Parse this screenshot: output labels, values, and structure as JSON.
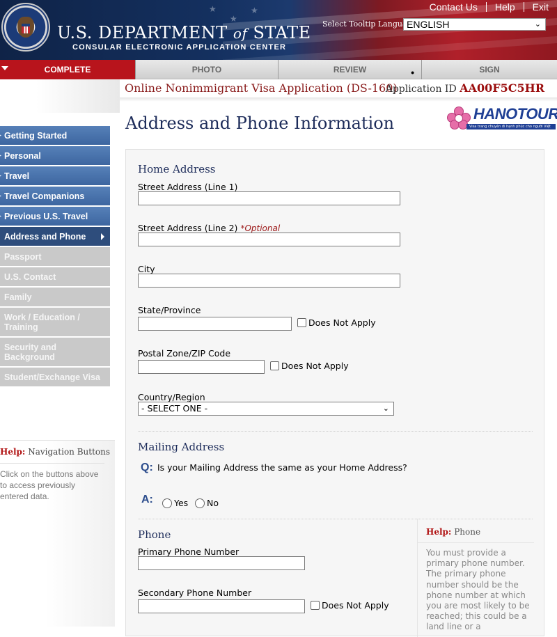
{
  "header": {
    "top_links": [
      "Contact Us",
      "Help",
      "Exit"
    ],
    "dept_title_pre": "U.S. Department ",
    "dept_title_of": "of",
    "dept_title_post": " State",
    "dept_subtitle": "CONSULAR ELECTRONIC APPLICATION CENTER",
    "tooltip_language_label": "Select Tooltip Language",
    "language_value": "ENGLISH"
  },
  "progress": {
    "steps": [
      "COMPLETE",
      "PHOTO",
      "REVIEW",
      "SIGN"
    ],
    "active": "COMPLETE"
  },
  "application": {
    "title": "Online Nonimmigrant Visa Application (DS-160)",
    "id_label": "Application ID",
    "id_value": "AA00F5C5HR"
  },
  "page": {
    "title": "Address and Phone Information"
  },
  "logo": {
    "text": "HANOTOURS",
    "tagline": "Visa trang chuyên đi hạnh phúc cho người Việt"
  },
  "nav": {
    "items": [
      {
        "label": "Getting Started",
        "state": "done"
      },
      {
        "label": "Personal",
        "state": "done"
      },
      {
        "label": "Travel",
        "state": "done"
      },
      {
        "label": "Travel Companions",
        "state": "done"
      },
      {
        "label": "Previous U.S. Travel",
        "state": "done"
      },
      {
        "label": "Address and Phone",
        "state": "current"
      },
      {
        "label": "Passport",
        "state": "todo"
      },
      {
        "label": "U.S. Contact",
        "state": "todo"
      },
      {
        "label": "Family",
        "state": "todo"
      },
      {
        "label": "Work / Education / Training",
        "state": "todo"
      },
      {
        "label": "Security and Background",
        "state": "todo"
      },
      {
        "label": "Student/Exchange Visa",
        "state": "todo"
      }
    ]
  },
  "side_help": {
    "prefix": "Help:",
    "title": "Navigation Buttons",
    "text": "Click on the buttons above to access previously entered data."
  },
  "home_address": {
    "section_title": "Home Address",
    "street1_label": "Street Address (Line 1)",
    "street1_value": "",
    "street2_label": "Street Address (Line 2)",
    "street2_optional": "*Optional",
    "street2_value": "",
    "city_label": "City",
    "city_value": "",
    "state_label": "State/Province",
    "state_value": "",
    "postal_label": "Postal Zone/ZIP Code",
    "postal_value": "",
    "does_not_apply": "Does Not Apply",
    "country_label": "Country/Region",
    "country_value": "- SELECT ONE -"
  },
  "mailing_address": {
    "section_title": "Mailing Address",
    "q_marker": "Q:",
    "question": "Is your Mailing Address the same as your Home Address?",
    "a_marker": "A:",
    "options": [
      "Yes",
      "No"
    ]
  },
  "phone": {
    "section_title": "Phone",
    "primary_label": "Primary Phone Number",
    "primary_value": "",
    "secondary_label": "Secondary Phone Number",
    "secondary_value": "",
    "does_not_apply": "Does Not Apply"
  },
  "phone_help": {
    "prefix": "Help:",
    "title": "Phone",
    "text": "You must provide a primary phone number. The primary phone number should be the phone number at which you are most likely to be reached; this could be a land line or a"
  }
}
